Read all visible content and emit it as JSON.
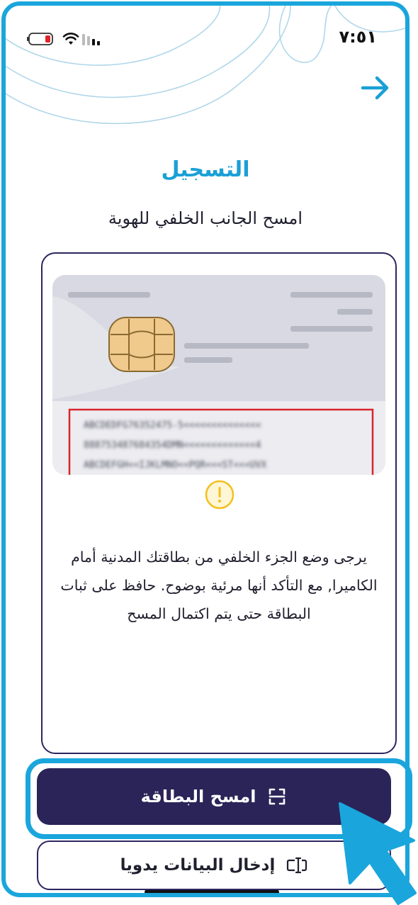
{
  "status_bar": {
    "time": "٧:٥١",
    "battery_level": 0.15
  },
  "header": {
    "back_icon": "arrow-right-icon",
    "title": "التسجيل",
    "subtitle": "امسح الجانب الخلفي للهوية"
  },
  "card": {
    "mrz_lines": [
      "ABCDEDFG76352475-5<<<<<<<<<<<<<<",
      "888753487684354DMN<<<<<<<<<<<<<4",
      "ABCDEFGH<<IJKLMNO<<PQR<<<ST<<<UVX"
    ],
    "highlight_color": "#d9252b"
  },
  "warning": {
    "icon": "warning-icon",
    "color": "#f2c01e",
    "text": "يرجى وضع الجزء الخلفي من بطاقتك المدنية أمام الكاميرا, مع التأكد أنها مرئية بوضوح. حافظ على ثبات البطاقة حتى يتم اكتمال المسح"
  },
  "actions": {
    "scan_label": "امسح البطاقة",
    "scan_icon": "scan-frame-icon",
    "manual_label": "إدخال البيانات يدويا",
    "manual_icon": "text-cursor-input-icon"
  },
  "colors": {
    "accent": "#1aa6dc",
    "primary": "#2b2458",
    "text": "#1f1f2e"
  }
}
